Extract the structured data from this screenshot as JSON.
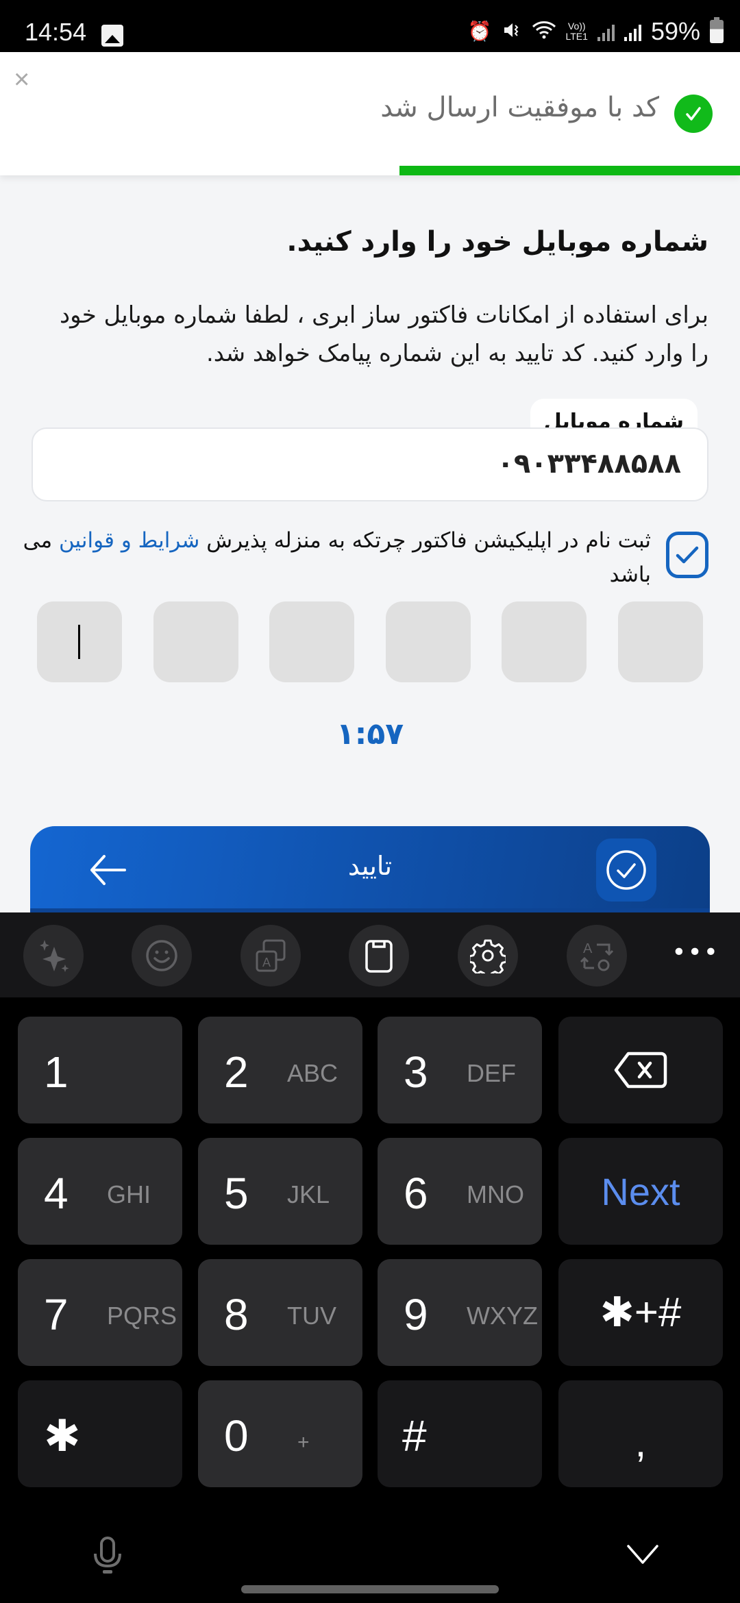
{
  "status_bar": {
    "time": "14:54",
    "network_label_top": "Vo))",
    "network_label_bottom": "LTE1",
    "battery": "59%"
  },
  "toast": {
    "message": "کد با موفقیت ارسال شد",
    "close_label": "×",
    "progress_fraction": 0.46,
    "colors": {
      "success": "#11BA1A",
      "progress": "#0DB814"
    }
  },
  "page": {
    "title": "شماره موبایل خود را وارد کنید.",
    "description": "برای استفاده از امکانات فاکتور ساز ابری ، لطفا شماره موبایل خود را وارد کنید. کد تایید به این شماره پیامک خواهد شد.",
    "phone_label": "شماره موبایل",
    "phone_value": "۰۹۰۳۳۴۸۸۵۸۸",
    "consent": {
      "checked": true,
      "text_before": "ثبت نام در اپلیکیشن فاکتور چرتکه به منزله پذیرش ",
      "link_text": "شرایط و قوانین",
      "text_after": " می باشد"
    },
    "otp_boxes": 6,
    "timer": "۱:۵۷",
    "confirm_label": "تایید",
    "accent_color": "#1565C0"
  },
  "keyboard": {
    "toolbar": [
      {
        "icon": "sparkle-icon"
      },
      {
        "icon": "emoji-icon"
      },
      {
        "icon": "translate-icon"
      },
      {
        "icon": "clipboard-icon"
      },
      {
        "icon": "settings-icon"
      },
      {
        "icon": "text-convert-icon"
      }
    ],
    "more_label": "•••",
    "keys": [
      {
        "num": "1",
        "sub": ""
      },
      {
        "num": "2",
        "sub": "ABC"
      },
      {
        "num": "3",
        "sub": "DEF"
      },
      {
        "num": "4",
        "sub": "GHI"
      },
      {
        "num": "5",
        "sub": "JKL"
      },
      {
        "num": "6",
        "sub": "MNO"
      },
      {
        "num": "7",
        "sub": "PQRS"
      },
      {
        "num": "8",
        "sub": "TUV"
      },
      {
        "num": "9",
        "sub": "WXYZ"
      },
      {
        "num": "0",
        "sub": "+"
      }
    ],
    "star": "✱",
    "hash": "#",
    "symbols": "✱+#",
    "comma": ",",
    "next_label": "Next",
    "next_color": "#5B8DEE"
  }
}
